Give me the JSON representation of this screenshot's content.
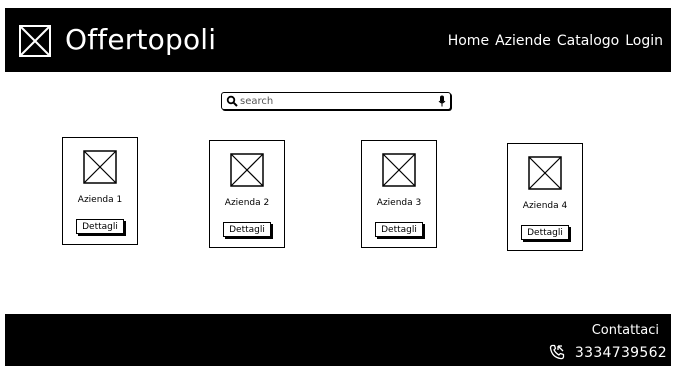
{
  "header": {
    "brand": "Offertopoli",
    "logo_icon": "image-placeholder-icon",
    "nav": [
      "Home",
      "Aziende",
      "Catalogo",
      "Login"
    ]
  },
  "search": {
    "placeholder": "search",
    "icons": [
      "search-icon",
      "microphone-icon"
    ]
  },
  "cards": [
    {
      "title": "Azienda 1",
      "button": "Dettagli"
    },
    {
      "title": "Azienda 2",
      "button": "Dettagli"
    },
    {
      "title": "Azienda 3",
      "button": "Dettagli"
    },
    {
      "title": "Azienda 4",
      "button": "Dettagli"
    }
  ],
  "footer": {
    "contact_title": "Contattaci",
    "phone": "3334739562",
    "phone_icon": "phone-icon"
  },
  "colors": {
    "header_bg": "#000000",
    "footer_bg": "#000000",
    "page_bg": "#ffffff",
    "text_on_dark": "#ffffff"
  }
}
